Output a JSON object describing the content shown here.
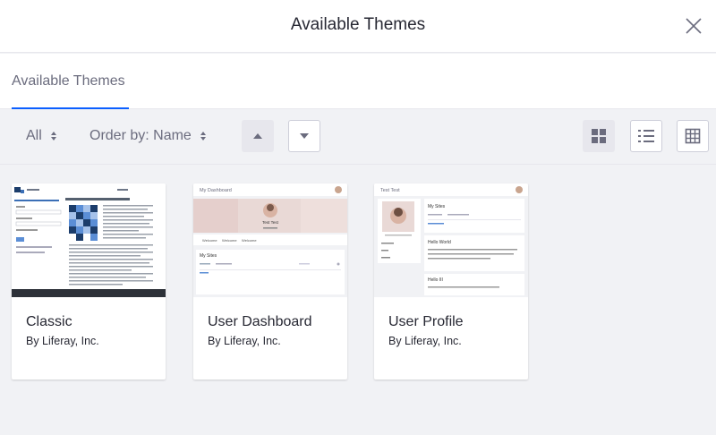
{
  "header": {
    "title": "Available Themes"
  },
  "tabs": [
    {
      "label": "Available Themes",
      "active": true
    }
  ],
  "filters": {
    "filter_label": "All",
    "order_label": "Order by: Name"
  },
  "colors": {
    "accent": "#0b5fff",
    "background": "#f1f2f5",
    "text": "#272833",
    "muted": "#6b6c7e"
  },
  "themes": [
    {
      "name": "Classic",
      "author": "By Liferay, Inc.",
      "thumbnail": "classic-theme"
    },
    {
      "name": "User Dashboard",
      "author": "By Liferay, Inc.",
      "thumbnail": "user-dashboard-theme",
      "preview": {
        "top_label": "My Dashboard",
        "user": "Test Test",
        "tabs": [
          "Welcome",
          "Welcome",
          "Welcome"
        ],
        "section": "My Sites"
      }
    },
    {
      "name": "User Profile",
      "author": "By Liferay, Inc.",
      "thumbnail": "user-profile-theme",
      "preview": {
        "top_label": "Test Test",
        "section": "My Sites",
        "items": [
          "Hello World",
          "Hello III"
        ]
      }
    }
  ]
}
